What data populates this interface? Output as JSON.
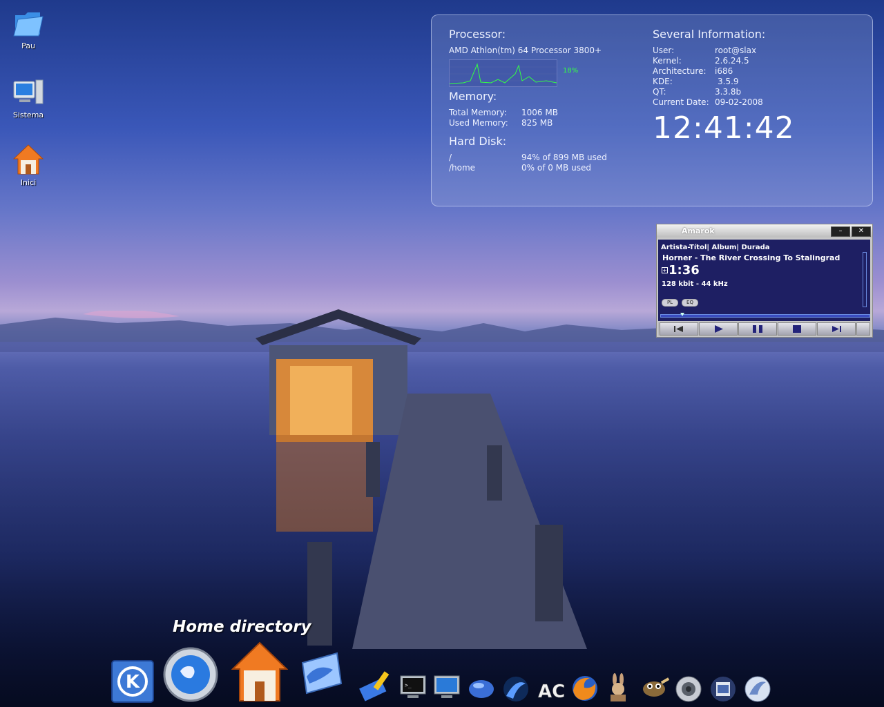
{
  "desktop_icons": [
    {
      "label": "Pau"
    },
    {
      "label": "Sistema"
    },
    {
      "label": "Inici"
    }
  ],
  "sysinfo": {
    "processor_heading": "Processor:",
    "processor_model": "AMD Athlon(tm) 64 Processor 3800+",
    "cpu_percent": "18%",
    "memory_heading": "Memory:",
    "total_memory_label": "Total Memory:",
    "total_memory_value": "1006 MB",
    "used_memory_label": "Used Memory:",
    "used_memory_value": "825 MB",
    "disk_heading": "Hard Disk:",
    "disk_root_label": "/",
    "disk_root_value": "94% of 899 MB used",
    "disk_home_label": "/home",
    "disk_home_value": "0% of 0 MB used",
    "info_heading": "Several Information:",
    "user_label": "User:",
    "user_value": "root@slax",
    "kernel_label": "Kernel:",
    "kernel_value": "2.6.24.5",
    "arch_label": "Architecture:",
    "arch_value": "i686",
    "kde_label": "KDE:",
    "kde_value": "3.5.9",
    "qt_label": "QT:",
    "qt_value": "3.3.8b",
    "date_label": "Current Date:",
    "date_value": "09-02-2008",
    "clock": "12:41:42"
  },
  "amarok": {
    "title": "Amarok",
    "minimize": "–",
    "close": "✕",
    "header": "Artista-Títol| Album| Durada",
    "track": "Horner - The River Crossing To Stalingrad",
    "time": "1:36",
    "bitrate": "128 kbit - 44 kHz",
    "pl_label": "PL",
    "eq_label": "EQ"
  },
  "dock": {
    "caption": "Home directory",
    "items": [
      "kde-menu-icon",
      "konqueror-globe-icon",
      "home-folder-icon",
      "kmail-icon",
      "kate-editor-icon",
      "konsole-terminal-icon",
      "desktop-icon",
      "kde-sphere-icon",
      "browser-swirl-icon",
      "ac-text-icon",
      "firefox-icon",
      "amule-bunny-icon",
      "gimp-icon",
      "speaker-icon",
      "media-player-icon",
      "dolphin-icon"
    ]
  },
  "colors": {
    "accent": "#3a57b8",
    "panel_text": "#eef2ff",
    "cpu_green": "#33ff44",
    "amarok_screen": "#1e1f63"
  }
}
